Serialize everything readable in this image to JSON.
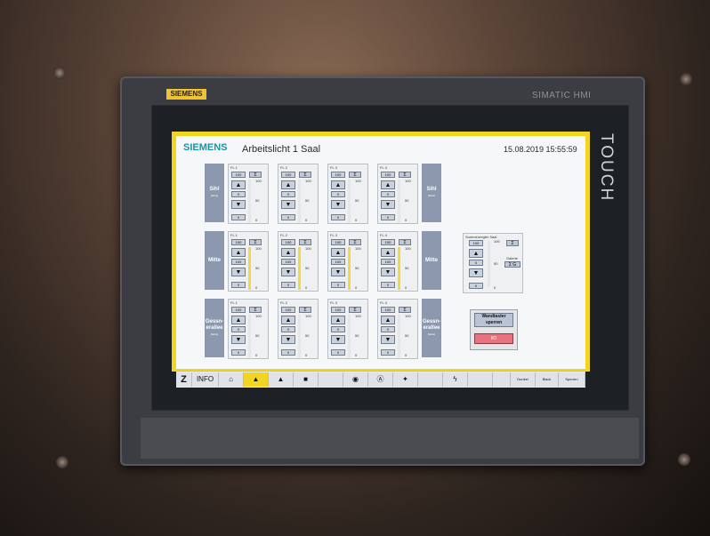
{
  "device": {
    "brand_plate": "SIEMENS",
    "model": "SIMATIC HMI",
    "bezel_label": "TOUCH"
  },
  "screen": {
    "brand": "SIEMENS",
    "title": "Arbeitslicht 1 Saal",
    "datetime": "15.08.2019 15:55:59",
    "accent_color": "#f1d521",
    "brand_color": "#1595a6"
  },
  "rows": [
    {
      "label_left": "Sihl",
      "sub_left": "(Weis)",
      "label_right": "Sihl",
      "sub_right": "(Weis)",
      "faders": [
        {
          "name": "FL 1",
          "set": "100",
          "value": "0",
          "level": "0",
          "scale_top": "100",
          "scale_mid": "50",
          "scale_bot": "0",
          "fill": 0
        },
        {
          "name": "FL 2",
          "set": "100",
          "value": "0",
          "level": "0",
          "scale_top": "100",
          "scale_mid": "50",
          "scale_bot": "0",
          "fill": 0
        },
        {
          "name": "FL 3",
          "set": "100",
          "value": "0",
          "level": "0",
          "scale_top": "100",
          "scale_mid": "50",
          "scale_bot": "0",
          "fill": 0
        },
        {
          "name": "FL 4",
          "set": "100",
          "value": "0",
          "level": "0",
          "scale_top": "100",
          "scale_mid": "50",
          "scale_bot": "0",
          "fill": 0
        }
      ]
    },
    {
      "label_left": "Mitte",
      "sub_left": "",
      "label_right": "Mitte",
      "sub_right": "",
      "faders": [
        {
          "name": "FL 1",
          "set": "100",
          "value": "100",
          "level": "0",
          "scale_top": "100",
          "scale_mid": "50",
          "scale_bot": "0",
          "fill": 1.0
        },
        {
          "name": "FL 2",
          "set": "100",
          "value": "100",
          "level": "0",
          "scale_top": "100",
          "scale_mid": "50",
          "scale_bot": "0",
          "fill": 1.0
        },
        {
          "name": "FL 3",
          "set": "100",
          "value": "100",
          "level": "0",
          "scale_top": "100",
          "scale_mid": "50",
          "scale_bot": "0",
          "fill": 1.0
        },
        {
          "name": "FL 4",
          "set": "100",
          "value": "100",
          "level": "0",
          "scale_top": "100",
          "scale_mid": "50",
          "scale_bot": "0",
          "fill": 1.0
        }
      ]
    },
    {
      "label_left": "Gessn-\nerallee",
      "sub_left": "(Weis)",
      "label_right": "Gessn-\nerallee",
      "sub_right": "(Weis)",
      "faders": [
        {
          "name": "FL 1",
          "set": "100",
          "value": "0",
          "level": "0",
          "scale_top": "100",
          "scale_mid": "50",
          "scale_bot": "0",
          "fill": 0
        },
        {
          "name": "FL 2",
          "set": "100",
          "value": "0",
          "level": "0",
          "scale_top": "100",
          "scale_mid": "50",
          "scale_bot": "0",
          "fill": 0
        },
        {
          "name": "FL 3",
          "set": "100",
          "value": "0",
          "level": "0",
          "scale_top": "100",
          "scale_mid": "50",
          "scale_bot": "0",
          "fill": 0
        },
        {
          "name": "FL 4",
          "set": "100",
          "value": "0",
          "level": "0",
          "scale_top": "100",
          "scale_mid": "50",
          "scale_bot": "0",
          "fill": 0
        }
      ]
    }
  ],
  "master": {
    "title": "Summenregler Saal",
    "set": "100",
    "value": "0",
    "level": "0",
    "scale_top": "100",
    "scale_mid": "50",
    "scale_bot": "0",
    "gallery_label": "Galerie",
    "sum": "Σ",
    "sum_gallery": "Σ G"
  },
  "fader_sum_label": "Σ",
  "wandtaster": {
    "title": "Wandtaster sperren",
    "button": "I/O",
    "button_color": "#e8727e"
  },
  "footer": {
    "logo": "Z",
    "info": "INFO",
    "dunkel": "Dunkel",
    "black": "Black",
    "sperren": "Sperren",
    "icons": [
      "home-icon",
      "light-icon-active",
      "light-icon",
      "monitor-icon",
      "eye-icon",
      "auto-icon",
      "lamp-icon",
      "lightning-icon"
    ]
  }
}
